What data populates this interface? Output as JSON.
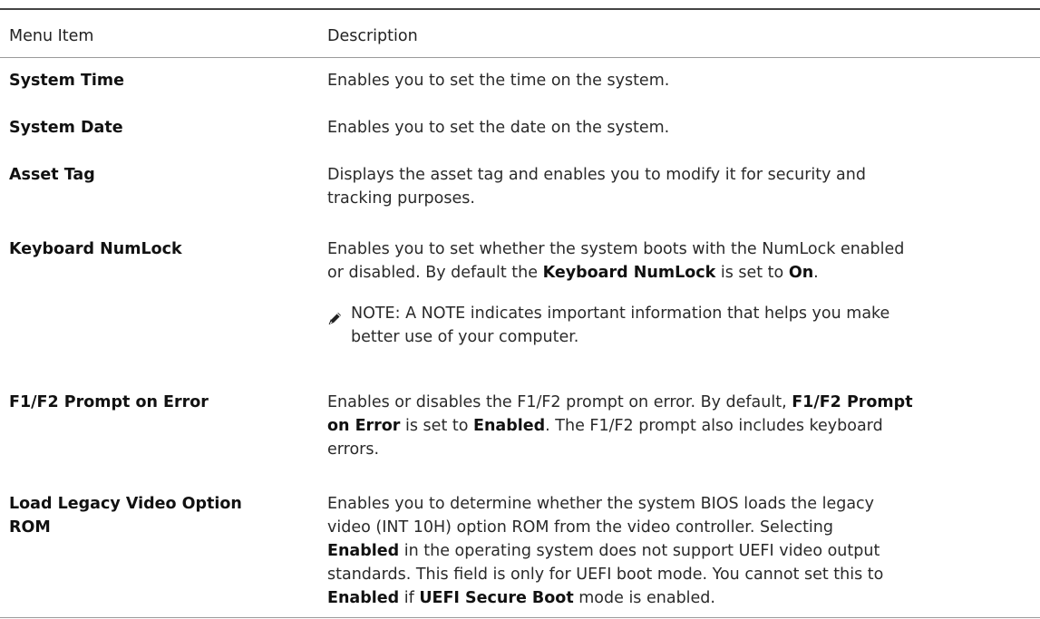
{
  "table": {
    "headers": {
      "menu_item": "Menu Item",
      "description": "Description"
    },
    "rows": [
      {
        "item": "System Time",
        "description_lines": [
          "Enables you to set the time on the system."
        ]
      },
      {
        "item": "System Date",
        "description_lines": [
          "Enables you to set the date on the system."
        ]
      },
      {
        "item": "Asset Tag",
        "description_lines": [
          "Displays the asset tag and enables you to modify it for security and",
          "tracking purposes."
        ]
      },
      {
        "item": "Keyboard NumLock",
        "description": {
          "line1": "Enables you to set whether the system boots with the NumLock enabled",
          "line2_prefix": "or disabled. By default the ",
          "line2_bold1": "Keyboard NumLock",
          "line2_mid": " is set to ",
          "line2_bold2": "On",
          "line2_suffix": "."
        },
        "note": {
          "icon": "note-pencil-icon",
          "line1": "NOTE: A NOTE indicates important information that helps you make",
          "line2": "better use of your computer."
        }
      },
      {
        "item": "F1/F2 Prompt on Error",
        "description": {
          "line1_prefix": "Enables or disables the F1/F2 prompt on error. By default, ",
          "line1_bold": "F1/F2 Prompt",
          "line2_bold": "on Error",
          "line2_mid": " is set to ",
          "line2_bold2": "Enabled",
          "line2_suffix": ". The F1/F2 prompt also includes keyboard",
          "line3": "errors."
        }
      },
      {
        "item_line1": "Load Legacy Video Option",
        "item_line2": "ROM",
        "description": {
          "line1": "Enables you to determine whether the system BIOS loads the legacy",
          "line2": "video (INT 10H) option ROM from the video controller. Selecting",
          "line3_bold": "Enabled",
          "line3_rest": " in the operating system does not support UEFI video output",
          "line4": "standards. This field is only for UEFI boot mode. You cannot set this to",
          "line5_bold1": "Enabled",
          "line5_mid": " if ",
          "line5_bold2": "UEFI Secure Boot",
          "line5_suffix": " mode is enabled."
        }
      }
    ]
  },
  "colors": {
    "text": "#222222",
    "rule": "#444444",
    "divider": "#9a9a9a"
  }
}
